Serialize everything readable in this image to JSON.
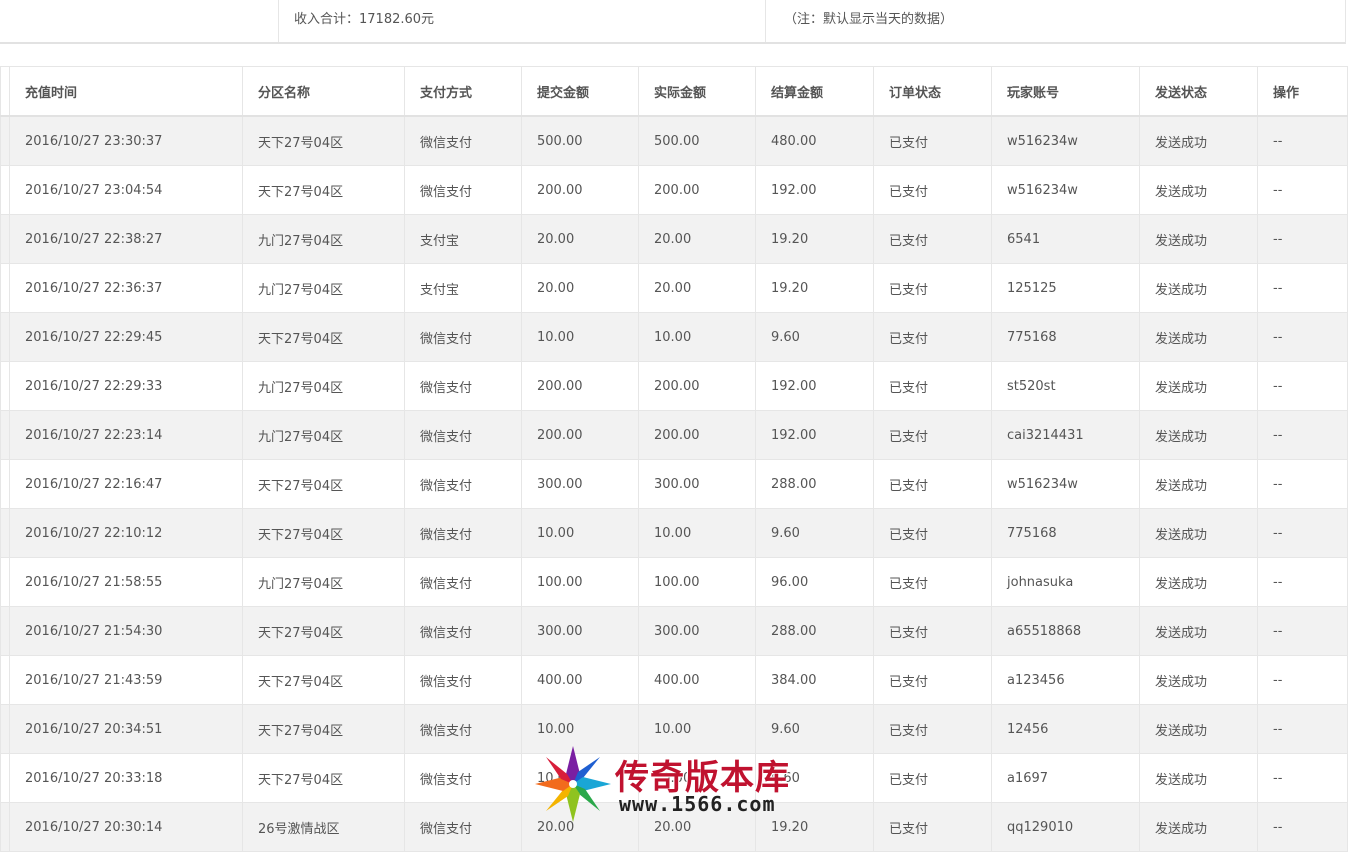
{
  "summary": {
    "income_total": "收入合计：17182.60元",
    "note": "（注：默认显示当天的数据）"
  },
  "table": {
    "headers": {
      "time": "充值时间",
      "area": "分区名称",
      "pay_method": "支付方式",
      "submit_amount": "提交金额",
      "actual_amount": "实际金额",
      "settle_amount": "结算金额",
      "order_status": "订单状态",
      "player_account": "玩家账号",
      "send_status": "发送状态",
      "operation": "操作"
    },
    "rows": [
      {
        "time": "2016/10/27 23:30:37",
        "area": "天下27号04区",
        "pay": "微信支付",
        "submit": "500.00",
        "actual": "500.00",
        "settle": "480.00",
        "status": "已支付",
        "account": "w516234w",
        "send": "发送成功",
        "op": "--"
      },
      {
        "time": "2016/10/27 23:04:54",
        "area": "天下27号04区",
        "pay": "微信支付",
        "submit": "200.00",
        "actual": "200.00",
        "settle": "192.00",
        "status": "已支付",
        "account": "w516234w",
        "send": "发送成功",
        "op": "--"
      },
      {
        "time": "2016/10/27 22:38:27",
        "area": "九门27号04区",
        "pay": "支付宝",
        "submit": "20.00",
        "actual": "20.00",
        "settle": "19.20",
        "status": "已支付",
        "account": "6541",
        "send": "发送成功",
        "op": "--"
      },
      {
        "time": "2016/10/27 22:36:37",
        "area": "九门27号04区",
        "pay": "支付宝",
        "submit": "20.00",
        "actual": "20.00",
        "settle": "19.20",
        "status": "已支付",
        "account": "125125",
        "send": "发送成功",
        "op": "--"
      },
      {
        "time": "2016/10/27 22:29:45",
        "area": "天下27号04区",
        "pay": "微信支付",
        "submit": "10.00",
        "actual": "10.00",
        "settle": "9.60",
        "status": "已支付",
        "account": "775168",
        "send": "发送成功",
        "op": "--"
      },
      {
        "time": "2016/10/27 22:29:33",
        "area": "九门27号04区",
        "pay": "微信支付",
        "submit": "200.00",
        "actual": "200.00",
        "settle": "192.00",
        "status": "已支付",
        "account": "st520st",
        "send": "发送成功",
        "op": "--"
      },
      {
        "time": "2016/10/27 22:23:14",
        "area": "九门27号04区",
        "pay": "微信支付",
        "submit": "200.00",
        "actual": "200.00",
        "settle": "192.00",
        "status": "已支付",
        "account": "cai3214431",
        "send": "发送成功",
        "op": "--"
      },
      {
        "time": "2016/10/27 22:16:47",
        "area": "天下27号04区",
        "pay": "微信支付",
        "submit": "300.00",
        "actual": "300.00",
        "settle": "288.00",
        "status": "已支付",
        "account": "w516234w",
        "send": "发送成功",
        "op": "--"
      },
      {
        "time": "2016/10/27 22:10:12",
        "area": "天下27号04区",
        "pay": "微信支付",
        "submit": "10.00",
        "actual": "10.00",
        "settle": "9.60",
        "status": "已支付",
        "account": "775168",
        "send": "发送成功",
        "op": "--"
      },
      {
        "time": "2016/10/27 21:58:55",
        "area": "九门27号04区",
        "pay": "微信支付",
        "submit": "100.00",
        "actual": "100.00",
        "settle": "96.00",
        "status": "已支付",
        "account": "johnasuka",
        "send": "发送成功",
        "op": "--"
      },
      {
        "time": "2016/10/27 21:54:30",
        "area": "天下27号04区",
        "pay": "微信支付",
        "submit": "300.00",
        "actual": "300.00",
        "settle": "288.00",
        "status": "已支付",
        "account": "a65518868",
        "send": "发送成功",
        "op": "--"
      },
      {
        "time": "2016/10/27 21:43:59",
        "area": "天下27号04区",
        "pay": "微信支付",
        "submit": "400.00",
        "actual": "400.00",
        "settle": "384.00",
        "status": "已支付",
        "account": "a123456",
        "send": "发送成功",
        "op": "--"
      },
      {
        "time": "2016/10/27 20:34:51",
        "area": "天下27号04区",
        "pay": "微信支付",
        "submit": "10.00",
        "actual": "10.00",
        "settle": "9.60",
        "status": "已支付",
        "account": "12456",
        "send": "发送成功",
        "op": "--"
      },
      {
        "time": "2016/10/27 20:33:18",
        "area": "天下27号04区",
        "pay": "微信支付",
        "submit": "10.00",
        "actual": "10.00",
        "settle": "9.60",
        "status": "已支付",
        "account": "a1697",
        "send": "发送成功",
        "op": "--"
      },
      {
        "time": "2016/10/27 20:30:14",
        "area": "26号激情战区",
        "pay": "微信支付",
        "submit": "20.00",
        "actual": "20.00",
        "settle": "19.20",
        "status": "已支付",
        "account": "qq129010",
        "send": "发送成功",
        "op": "--"
      }
    ]
  },
  "watermark": {
    "title": "传奇版本库",
    "url": "www.1566.com",
    "icon": "star-logo-icon"
  },
  "colors": {
    "row_stripe": "#f2f2f2",
    "border": "#e6e6e6",
    "text": "#555555",
    "watermark_red": "#c0122f"
  }
}
